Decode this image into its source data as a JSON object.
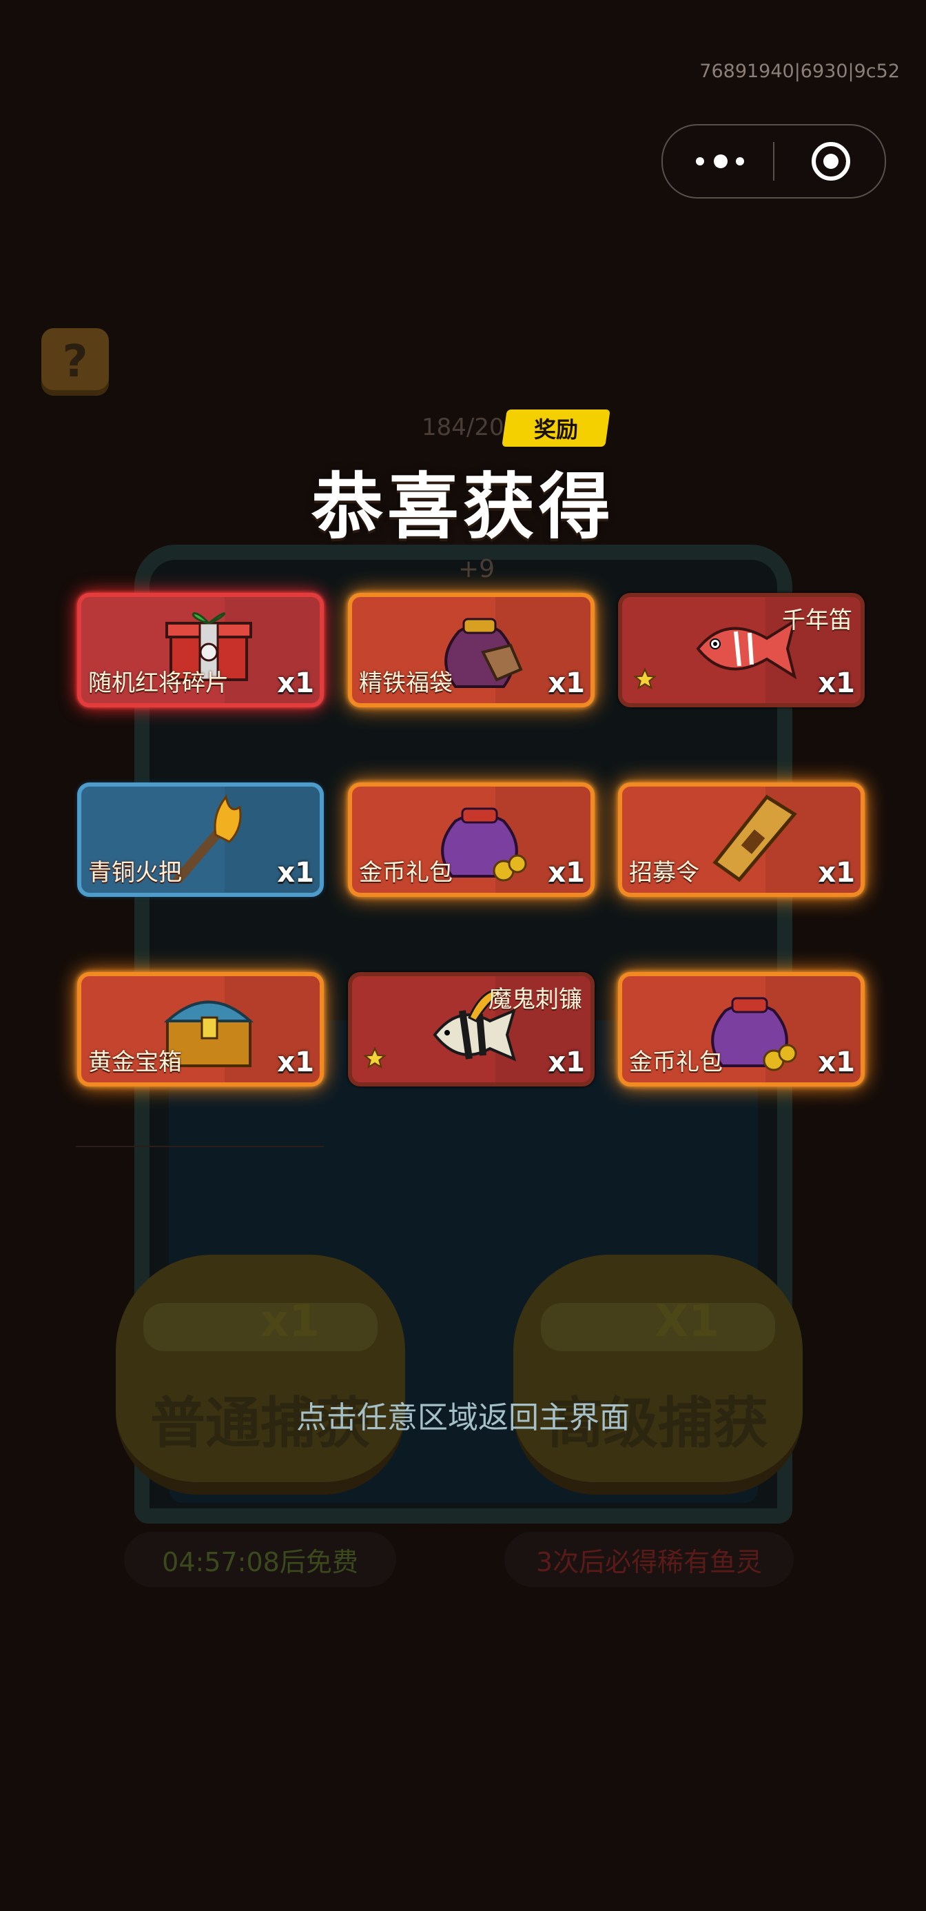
{
  "header": {
    "build_id": "76891940|6930|9c52"
  },
  "capsule": {
    "more_icon": "more-dots-icon",
    "close_icon": "target-circle-icon"
  },
  "help_icon": "question-mark-icon",
  "background": {
    "progress": "184/20",
    "plus": "+9",
    "normal_count": "x1",
    "normal_label": "普通捕获",
    "advanced_count": "X1",
    "advanced_label": "高级捕获",
    "timer": "04:57:08后免费",
    "guarantee": "3次后必得稀有鱼灵"
  },
  "reward_badge": "奖励",
  "title": "恭喜获得",
  "items": [
    {
      "name": "随机红将碎片",
      "qty": "x1",
      "rarity": "red",
      "icon": "red-gift-box-icon"
    },
    {
      "name": "精铁福袋",
      "qty": "x1",
      "rarity": "orange",
      "icon": "ore-pouch-icon"
    },
    {
      "name": "千年笛",
      "qty": "x1",
      "rarity": "fish",
      "icon": "red-fish-icon",
      "starred": true
    },
    {
      "name": "青铜火把",
      "qty": "x1",
      "rarity": "blue",
      "icon": "torch-icon"
    },
    {
      "name": "金币礼包",
      "qty": "x1",
      "rarity": "orange",
      "icon": "coin-pouch-icon"
    },
    {
      "name": "招募令",
      "qty": "x1",
      "rarity": "orange",
      "icon": "recruit-token-icon"
    },
    {
      "name": "黄金宝箱",
      "qty": "x1",
      "rarity": "orange",
      "icon": "golden-chest-icon"
    },
    {
      "name": "魔鬼刺镰",
      "qty": "x1",
      "rarity": "fish",
      "icon": "angelfish-icon",
      "starred": true
    },
    {
      "name": "金币礼包",
      "qty": "x1",
      "rarity": "orange",
      "icon": "coin-pouch-icon"
    }
  ],
  "hint": "点击任意区域返回主界面",
  "colors": {
    "title": "#ffffff",
    "badge": "#f5d000",
    "red_glow": "#ff2a2a",
    "orange_glow": "#ff8a1a",
    "blue_card": "#2e6488"
  }
}
